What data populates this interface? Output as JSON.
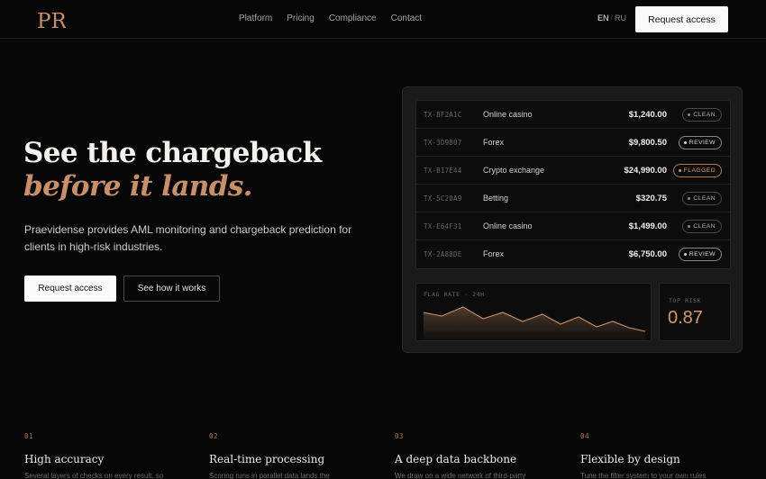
{
  "header": {
    "logo_text": "PR",
    "nav": [
      "Platform",
      "Pricing",
      "Compliance",
      "Contact"
    ],
    "lang_active": "EN",
    "lang_sep": "/",
    "lang_other": "RU",
    "cta": "Request access",
    "accent_color": "#c98f67"
  },
  "hero": {
    "title_line1": "See the chargeback",
    "title_line2": "before it lands.",
    "description": "Praevidense provides AML monitoring and chargeback prediction for clients in high-risk industries.",
    "primary_btn": "Request access",
    "secondary_btn": "See how it works"
  },
  "dashboard": {
    "transactions": [
      {
        "id": "TX-8F2A1C",
        "category": "Online casino",
        "amount": "$1,240.00",
        "status": "CLEAN",
        "status_type": "clean"
      },
      {
        "id": "TX-3D9B07",
        "category": "Forex",
        "amount": "$9,800.50",
        "status": "REVIEW",
        "status_type": "review"
      },
      {
        "id": "TX-B17E44",
        "category": "Crypto exchange",
        "amount": "$24,990.00",
        "status": "FLAGGED",
        "status_type": "flagged"
      },
      {
        "id": "TX-5C20A9",
        "category": "Betting",
        "amount": "$320.75",
        "status": "CLEAN",
        "status_type": "clean"
      },
      {
        "id": "TX-E64F31",
        "category": "Online casino",
        "amount": "$1,499.00",
        "status": "CLEAN",
        "status_type": "clean"
      },
      {
        "id": "TX-2A88DE",
        "category": "Forex",
        "amount": "$6,750.00",
        "status": "REVIEW",
        "status_type": "review"
      }
    ],
    "flag_rate_label": "FLAG RATE · 24H",
    "top_risk_label": "TOP RISK",
    "top_risk_value": "0.87"
  },
  "features": [
    {
      "num": "01",
      "title": "High accuracy",
      "desc": "Several layers of checks on every result, so"
    },
    {
      "num": "02",
      "title": "Real-time processing",
      "desc": "Scoring runs in parallel data lands the"
    },
    {
      "num": "03",
      "title": "A deep data backbone",
      "desc": "We draw on a wide network of third-party"
    },
    {
      "num": "04",
      "title": "Flexible by design",
      "desc": "Tune the filter system to your own rules"
    }
  ]
}
